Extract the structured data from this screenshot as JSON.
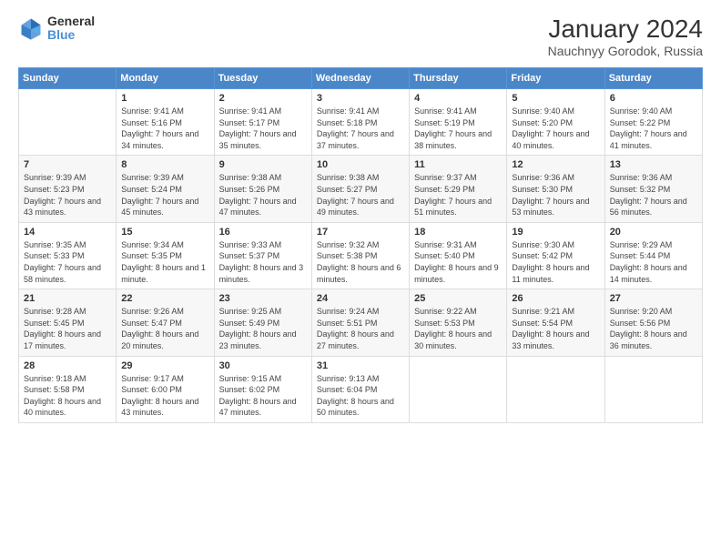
{
  "header": {
    "logo": {
      "general": "General",
      "blue": "Blue"
    },
    "title": "January 2024",
    "location": "Nauchnyy Gorodok, Russia"
  },
  "calendar": {
    "days_of_week": [
      "Sunday",
      "Monday",
      "Tuesday",
      "Wednesday",
      "Thursday",
      "Friday",
      "Saturday"
    ],
    "weeks": [
      [
        {
          "day": "",
          "sunrise": "",
          "sunset": "",
          "daylight": ""
        },
        {
          "day": "1",
          "sunrise": "Sunrise: 9:41 AM",
          "sunset": "Sunset: 5:16 PM",
          "daylight": "Daylight: 7 hours and 34 minutes."
        },
        {
          "day": "2",
          "sunrise": "Sunrise: 9:41 AM",
          "sunset": "Sunset: 5:17 PM",
          "daylight": "Daylight: 7 hours and 35 minutes."
        },
        {
          "day": "3",
          "sunrise": "Sunrise: 9:41 AM",
          "sunset": "Sunset: 5:18 PM",
          "daylight": "Daylight: 7 hours and 37 minutes."
        },
        {
          "day": "4",
          "sunrise": "Sunrise: 9:41 AM",
          "sunset": "Sunset: 5:19 PM",
          "daylight": "Daylight: 7 hours and 38 minutes."
        },
        {
          "day": "5",
          "sunrise": "Sunrise: 9:40 AM",
          "sunset": "Sunset: 5:20 PM",
          "daylight": "Daylight: 7 hours and 40 minutes."
        },
        {
          "day": "6",
          "sunrise": "Sunrise: 9:40 AM",
          "sunset": "Sunset: 5:22 PM",
          "daylight": "Daylight: 7 hours and 41 minutes."
        }
      ],
      [
        {
          "day": "7",
          "sunrise": "Sunrise: 9:39 AM",
          "sunset": "Sunset: 5:23 PM",
          "daylight": "Daylight: 7 hours and 43 minutes."
        },
        {
          "day": "8",
          "sunrise": "Sunrise: 9:39 AM",
          "sunset": "Sunset: 5:24 PM",
          "daylight": "Daylight: 7 hours and 45 minutes."
        },
        {
          "day": "9",
          "sunrise": "Sunrise: 9:38 AM",
          "sunset": "Sunset: 5:26 PM",
          "daylight": "Daylight: 7 hours and 47 minutes."
        },
        {
          "day": "10",
          "sunrise": "Sunrise: 9:38 AM",
          "sunset": "Sunset: 5:27 PM",
          "daylight": "Daylight: 7 hours and 49 minutes."
        },
        {
          "day": "11",
          "sunrise": "Sunrise: 9:37 AM",
          "sunset": "Sunset: 5:29 PM",
          "daylight": "Daylight: 7 hours and 51 minutes."
        },
        {
          "day": "12",
          "sunrise": "Sunrise: 9:36 AM",
          "sunset": "Sunset: 5:30 PM",
          "daylight": "Daylight: 7 hours and 53 minutes."
        },
        {
          "day": "13",
          "sunrise": "Sunrise: 9:36 AM",
          "sunset": "Sunset: 5:32 PM",
          "daylight": "Daylight: 7 hours and 56 minutes."
        }
      ],
      [
        {
          "day": "14",
          "sunrise": "Sunrise: 9:35 AM",
          "sunset": "Sunset: 5:33 PM",
          "daylight": "Daylight: 7 hours and 58 minutes."
        },
        {
          "day": "15",
          "sunrise": "Sunrise: 9:34 AM",
          "sunset": "Sunset: 5:35 PM",
          "daylight": "Daylight: 8 hours and 1 minute."
        },
        {
          "day": "16",
          "sunrise": "Sunrise: 9:33 AM",
          "sunset": "Sunset: 5:37 PM",
          "daylight": "Daylight: 8 hours and 3 minutes."
        },
        {
          "day": "17",
          "sunrise": "Sunrise: 9:32 AM",
          "sunset": "Sunset: 5:38 PM",
          "daylight": "Daylight: 8 hours and 6 minutes."
        },
        {
          "day": "18",
          "sunrise": "Sunrise: 9:31 AM",
          "sunset": "Sunset: 5:40 PM",
          "daylight": "Daylight: 8 hours and 9 minutes."
        },
        {
          "day": "19",
          "sunrise": "Sunrise: 9:30 AM",
          "sunset": "Sunset: 5:42 PM",
          "daylight": "Daylight: 8 hours and 11 minutes."
        },
        {
          "day": "20",
          "sunrise": "Sunrise: 9:29 AM",
          "sunset": "Sunset: 5:44 PM",
          "daylight": "Daylight: 8 hours and 14 minutes."
        }
      ],
      [
        {
          "day": "21",
          "sunrise": "Sunrise: 9:28 AM",
          "sunset": "Sunset: 5:45 PM",
          "daylight": "Daylight: 8 hours and 17 minutes."
        },
        {
          "day": "22",
          "sunrise": "Sunrise: 9:26 AM",
          "sunset": "Sunset: 5:47 PM",
          "daylight": "Daylight: 8 hours and 20 minutes."
        },
        {
          "day": "23",
          "sunrise": "Sunrise: 9:25 AM",
          "sunset": "Sunset: 5:49 PM",
          "daylight": "Daylight: 8 hours and 23 minutes."
        },
        {
          "day": "24",
          "sunrise": "Sunrise: 9:24 AM",
          "sunset": "Sunset: 5:51 PM",
          "daylight": "Daylight: 8 hours and 27 minutes."
        },
        {
          "day": "25",
          "sunrise": "Sunrise: 9:22 AM",
          "sunset": "Sunset: 5:53 PM",
          "daylight": "Daylight: 8 hours and 30 minutes."
        },
        {
          "day": "26",
          "sunrise": "Sunrise: 9:21 AM",
          "sunset": "Sunset: 5:54 PM",
          "daylight": "Daylight: 8 hours and 33 minutes."
        },
        {
          "day": "27",
          "sunrise": "Sunrise: 9:20 AM",
          "sunset": "Sunset: 5:56 PM",
          "daylight": "Daylight: 8 hours and 36 minutes."
        }
      ],
      [
        {
          "day": "28",
          "sunrise": "Sunrise: 9:18 AM",
          "sunset": "Sunset: 5:58 PM",
          "daylight": "Daylight: 8 hours and 40 minutes."
        },
        {
          "day": "29",
          "sunrise": "Sunrise: 9:17 AM",
          "sunset": "Sunset: 6:00 PM",
          "daylight": "Daylight: 8 hours and 43 minutes."
        },
        {
          "day": "30",
          "sunrise": "Sunrise: 9:15 AM",
          "sunset": "Sunset: 6:02 PM",
          "daylight": "Daylight: 8 hours and 47 minutes."
        },
        {
          "day": "31",
          "sunrise": "Sunrise: 9:13 AM",
          "sunset": "Sunset: 6:04 PM",
          "daylight": "Daylight: 8 hours and 50 minutes."
        },
        {
          "day": "",
          "sunrise": "",
          "sunset": "",
          "daylight": ""
        },
        {
          "day": "",
          "sunrise": "",
          "sunset": "",
          "daylight": ""
        },
        {
          "day": "",
          "sunrise": "",
          "sunset": "",
          "daylight": ""
        }
      ]
    ]
  }
}
